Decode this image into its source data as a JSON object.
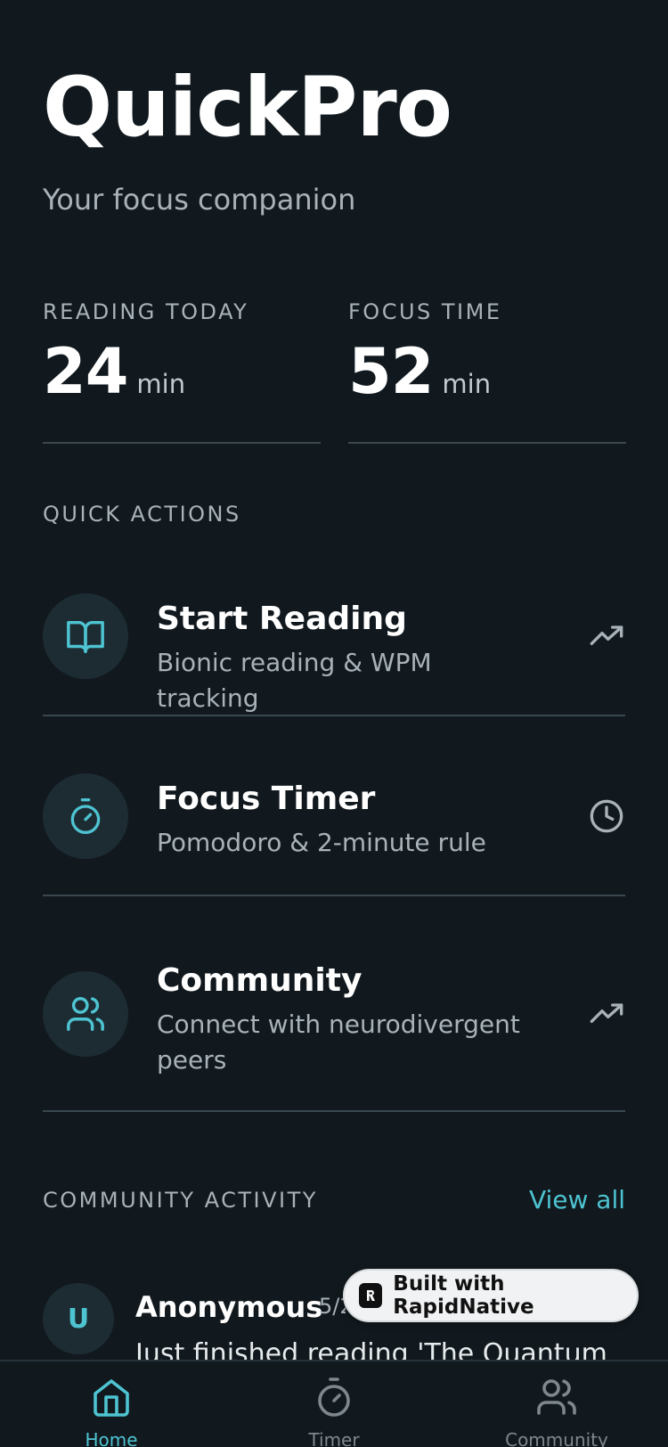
{
  "app": {
    "title": "QuickPro",
    "subtitle": "Your focus companion"
  },
  "stats": [
    {
      "label": "READING TODAY",
      "value": "24",
      "unit": "min"
    },
    {
      "label": "FOCUS TIME",
      "value": "52",
      "unit": "min"
    }
  ],
  "quick_actions": {
    "label": "QUICK ACTIONS",
    "items": [
      {
        "title": "Start Reading",
        "subtitle": "Bionic reading & WPM tracking",
        "icon": "book-open-icon",
        "trail_icon": "trending-up-icon"
      },
      {
        "title": "Focus Timer",
        "subtitle": "Pomodoro & 2-minute rule",
        "icon": "stopwatch-icon",
        "trail_icon": "clock-icon"
      },
      {
        "title": "Community",
        "subtitle": "Connect with neurodivergent peers",
        "icon": "users-icon",
        "trail_icon": "trending-up-icon"
      }
    ]
  },
  "community_activity": {
    "label": "COMMUNITY ACTIVITY",
    "view_all": "View all",
    "posts": [
      {
        "avatar_letter": "U",
        "name": "Anonymous",
        "date": "5/2",
        "text": "Just finished reading 'The Quantum"
      }
    ]
  },
  "badge": {
    "text": "Built with RapidNative"
  },
  "tabs": [
    {
      "label": "Home",
      "icon": "home-icon",
      "active": true
    },
    {
      "label": "Timer",
      "icon": "stopwatch-icon",
      "active": false
    },
    {
      "label": "Community",
      "icon": "users-icon",
      "active": false
    }
  ],
  "colors": {
    "background": "#11191e",
    "accent": "#4ec3d1",
    "muted_text": "#a9b2b9",
    "divider": "#3b474f"
  }
}
